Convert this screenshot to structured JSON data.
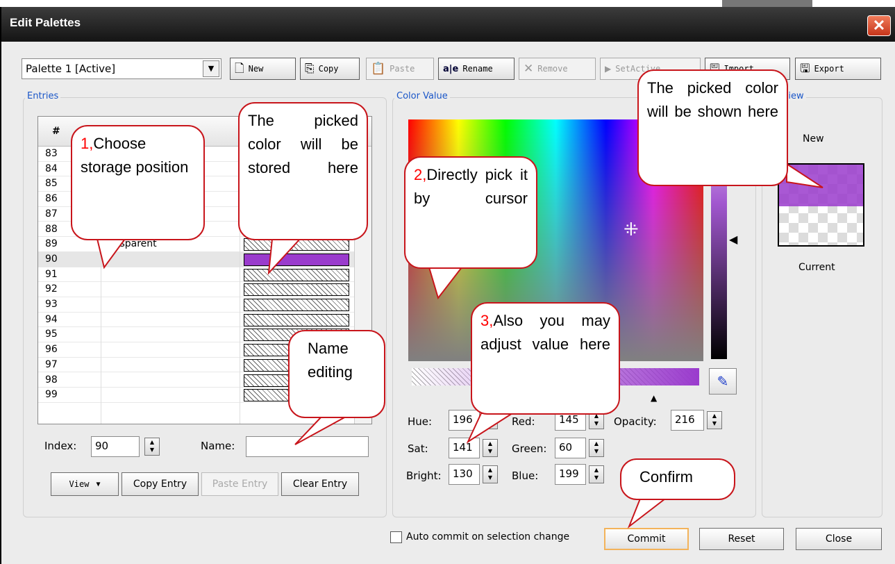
{
  "window": {
    "title": "Edit Palettes",
    "close_glyph": "✕"
  },
  "toolbar": {
    "palette_select": "Palette 1 [Active]",
    "buttons": [
      {
        "label": "New",
        "icon": "new-document-icon",
        "glyph": "🗋",
        "enabled": true
      },
      {
        "label": "Copy",
        "icon": "copy-icon",
        "glyph": "⎘",
        "enabled": true
      },
      {
        "label": "Paste",
        "icon": "paste-icon",
        "glyph": "📋",
        "enabled": false
      },
      {
        "label": "Rename",
        "icon": "rename-icon",
        "glyph": "a|e",
        "enabled": true
      },
      {
        "label": "Remove",
        "icon": "remove-icon",
        "glyph": "✕",
        "enabled": false
      },
      {
        "label": "SetActive",
        "icon": "set-active-icon",
        "glyph": "▶",
        "enabled": false
      },
      {
        "label": "Import",
        "icon": "import-icon",
        "glyph": "🖫",
        "enabled": true
      },
      {
        "label": "Export",
        "icon": "export-icon",
        "glyph": "🖫",
        "enabled": true
      }
    ]
  },
  "entries": {
    "group_label": "Entries",
    "header_num": "#",
    "rows": [
      {
        "num": "83",
        "name": ""
      },
      {
        "num": "84",
        "name": ""
      },
      {
        "num": "85",
        "name": ""
      },
      {
        "num": "86",
        "name": ""
      },
      {
        "num": "87",
        "name": ""
      },
      {
        "num": "88",
        "name": ""
      },
      {
        "num": "89",
        "name": "ansparent"
      },
      {
        "num": "90",
        "name": ""
      },
      {
        "num": "91",
        "name": ""
      },
      {
        "num": "92",
        "name": ""
      },
      {
        "num": "93",
        "name": ""
      },
      {
        "num": "94",
        "name": ""
      },
      {
        "num": "95",
        "name": ""
      },
      {
        "num": "96",
        "name": ""
      },
      {
        "num": "97",
        "name": ""
      },
      {
        "num": "98",
        "name": ""
      },
      {
        "num": "99",
        "name": ""
      }
    ],
    "selected_row": "90",
    "selected_color": "#9a3bcd",
    "index_label": "Index:",
    "index_value": "90",
    "name_label": "Name:",
    "name_value": "",
    "view_button": "View",
    "copy_entry": "Copy Entry",
    "paste_entry": "Paste Entry",
    "clear_entry": "Clear Entry"
  },
  "color_value": {
    "group_label": "Color Value",
    "hue_label": "Hue:",
    "hue": "196",
    "sat_label": "Sat:",
    "sat": "141",
    "bright_label": "Bright:",
    "bright": "130",
    "red_label": "Red:",
    "red": "145",
    "green_label": "Green:",
    "green": "60",
    "blue_label": "Blue:",
    "blue": "199",
    "opacity_label": "Opacity:",
    "opacity": "216"
  },
  "preview": {
    "group_label": "Preview",
    "new_label": "New",
    "current_label": "Current"
  },
  "bottom": {
    "auto_commit": "Auto commit on selection change",
    "commit": "Commit",
    "reset": "Reset",
    "close": "Close"
  },
  "callouts": {
    "c1_num": "1,",
    "c1_text": "Choose storage position",
    "c2_num": "2,",
    "c2_text": "Directly pick it by cursor",
    "c3_num": "3,",
    "c3_text": "Also you may adjust value here",
    "stored": "The picked color will be stored here",
    "shown": "The picked color will be shown here",
    "name_edit": "Name editing",
    "confirm": "Confirm"
  },
  "colors": {
    "callout_border": "#c8151b",
    "callout_number": "#ff0000",
    "group_label": "#1a56c8",
    "selected_swatch": "#9a3bcd"
  }
}
